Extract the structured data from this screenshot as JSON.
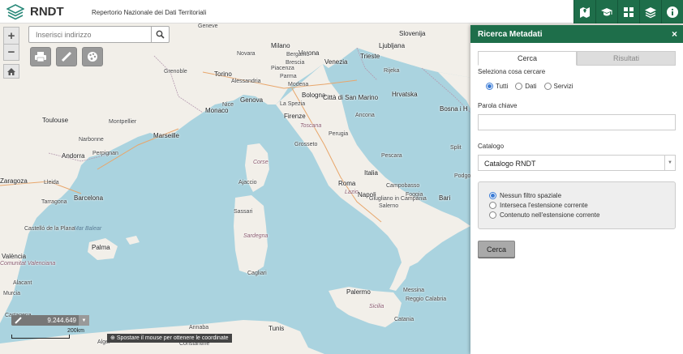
{
  "header": {
    "brand": "RNDT",
    "subtitle": "Repertorio Nazionale dei Dati Territoriali",
    "tools": [
      {
        "icon": "map-book-icon",
        "title": "Catalogo"
      },
      {
        "icon": "graduation-cap-icon",
        "title": "Guida"
      },
      {
        "icon": "grid-icon",
        "title": "Widget"
      },
      {
        "icon": "layers-icon",
        "title": "Livelli"
      },
      {
        "icon": "info-icon",
        "title": "Info"
      }
    ]
  },
  "map": {
    "search_placeholder": "Inserisci indirizzo",
    "zoom_in": "+",
    "zoom_out": "−",
    "scale_value": "9.244.649",
    "scale_label": "200km",
    "coord_hint": "Spostare il mouse per ottenere le coordinate",
    "places": [
      {
        "name": "Geneve",
        "cls": "small"
      },
      {
        "name": "Milano",
        "cls": ""
      },
      {
        "name": "Verona",
        "cls": ""
      },
      {
        "name": "Venezia",
        "cls": ""
      },
      {
        "name": "Trieste",
        "cls": ""
      },
      {
        "name": "Ljubljana",
        "cls": ""
      },
      {
        "name": "Slovenija",
        "cls": ""
      },
      {
        "name": "Novara",
        "cls": "small"
      },
      {
        "name": "Bergamo",
        "cls": "small"
      },
      {
        "name": "Brescia",
        "cls": "small"
      },
      {
        "name": "Torino",
        "cls": ""
      },
      {
        "name": "Piacenza",
        "cls": "small"
      },
      {
        "name": "Alessandria",
        "cls": "small"
      },
      {
        "name": "Parma",
        "cls": "small"
      },
      {
        "name": "Modena",
        "cls": "small"
      },
      {
        "name": "Bologna",
        "cls": ""
      },
      {
        "name": "Genova",
        "cls": ""
      },
      {
        "name": "Grenoble",
        "cls": "small"
      },
      {
        "name": "Hrvatska",
        "cls": ""
      },
      {
        "name": "Monaco",
        "cls": ""
      },
      {
        "name": "Nice",
        "cls": "small"
      },
      {
        "name": "La Spezia",
        "cls": "small"
      },
      {
        "name": "Città di San Marino",
        "cls": ""
      },
      {
        "name": "Ancona",
        "cls": "small"
      },
      {
        "name": "Toulouse",
        "cls": ""
      },
      {
        "name": "Firenze",
        "cls": ""
      },
      {
        "name": "Bosna i H",
        "cls": ""
      },
      {
        "name": "Marseille",
        "cls": ""
      },
      {
        "name": "Toscana",
        "cls": "region"
      },
      {
        "name": "Perugia",
        "cls": "small"
      },
      {
        "name": "Grosseto",
        "cls": "small"
      },
      {
        "name": "Italia",
        "cls": ""
      },
      {
        "name": "Andorra",
        "cls": ""
      },
      {
        "name": "Perpignan",
        "cls": "small"
      },
      {
        "name": "Corse",
        "cls": "region"
      },
      {
        "name": "Roma",
        "cls": ""
      },
      {
        "name": "Lazio",
        "cls": "region"
      },
      {
        "name": "Pescara",
        "cls": "small"
      },
      {
        "name": "Campobasso",
        "cls": "small"
      },
      {
        "name": "Zaragoza",
        "cls": ""
      },
      {
        "name": "Lleida",
        "cls": "small"
      },
      {
        "name": "Tarragona",
        "cls": "small"
      },
      {
        "name": "Barcelona",
        "cls": ""
      },
      {
        "name": "Ajaccio",
        "cls": "small"
      },
      {
        "name": "Foggia",
        "cls": "small"
      },
      {
        "name": "Bari",
        "cls": ""
      },
      {
        "name": "Napoli",
        "cls": ""
      },
      {
        "name": "Giugliano in Campania",
        "cls": "small"
      },
      {
        "name": "Salerno",
        "cls": "small"
      },
      {
        "name": "Sassari",
        "cls": "small"
      },
      {
        "name": "Mar Balear",
        "cls": "sea"
      },
      {
        "name": "Castelló de la Plana",
        "cls": "small"
      },
      {
        "name": "Sardegna",
        "cls": "region"
      },
      {
        "name": "Palma",
        "cls": ""
      },
      {
        "name": "València",
        "cls": ""
      },
      {
        "name": "Comunitat Valenciana",
        "cls": "region"
      },
      {
        "name": "Alacant",
        "cls": "small"
      },
      {
        "name": "Cagliari",
        "cls": "small"
      },
      {
        "name": "Palermo",
        "cls": ""
      },
      {
        "name": "Messina",
        "cls": "small"
      },
      {
        "name": "Reggio Calabria",
        "cls": "small"
      },
      {
        "name": "Catania",
        "cls": "small"
      },
      {
        "name": "Annaba",
        "cls": "small"
      },
      {
        "name": "Tunis",
        "cls": ""
      },
      {
        "name": "Constantine",
        "cls": "small"
      },
      {
        "name": "Alger",
        "cls": "small"
      },
      {
        "name": "Sicilia",
        "cls": "region"
      },
      {
        "name": "Murcia",
        "cls": "small"
      },
      {
        "name": "Cartagena",
        "cls": "small"
      },
      {
        "name": "Montpellier",
        "cls": "small"
      },
      {
        "name": "Narbonne",
        "cls": "small"
      },
      {
        "name": "Rijeka",
        "cls": "small"
      },
      {
        "name": "Split",
        "cls": "small"
      },
      {
        "name": "Podgorica",
        "cls": "small"
      }
    ]
  },
  "panel": {
    "title": "Ricerca Metadati",
    "close": "×",
    "tab_search": "Cerca",
    "tab_results": "Risultati",
    "select_label": "Seleziona cosa cercare",
    "type_options": [
      {
        "label": "Tutti",
        "checked": true
      },
      {
        "label": "Dati",
        "checked": false
      },
      {
        "label": "Servizi",
        "checked": false
      }
    ],
    "keyword_label": "Parola chiave",
    "keyword_value": "",
    "catalog_label": "Catalogo",
    "catalog_value": "Catalogo RNDT",
    "spatial_options": [
      {
        "label": "Nessun filtro spaziale",
        "checked": true
      },
      {
        "label": "Interseca l'estensione corrente",
        "checked": false
      },
      {
        "label": "Contenuto nell'estensione corrente",
        "checked": false
      }
    ],
    "search_button": "Cerca"
  },
  "colors": {
    "accent": "#1e6e4a",
    "sea": "#aad3df",
    "land": "#f2efe9"
  }
}
